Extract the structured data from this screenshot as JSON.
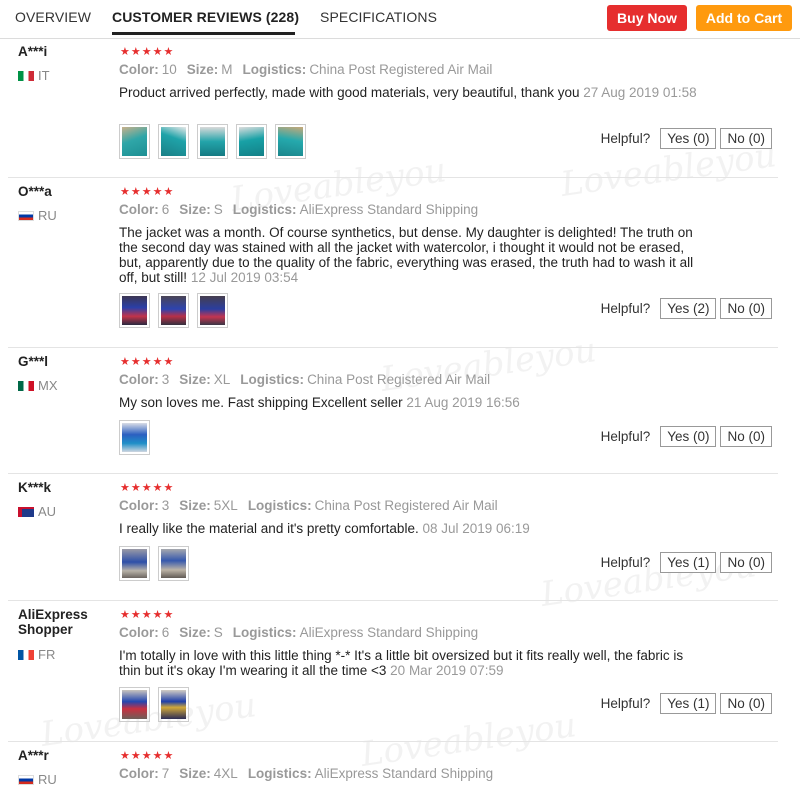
{
  "tabs": {
    "overview": "OVERVIEW",
    "reviews": "CUSTOMER REVIEWS (228)",
    "specs": "SPECIFICATIONS"
  },
  "actions": {
    "buy_now": "Buy Now",
    "add_to_cart": "Add to Cart"
  },
  "labels": {
    "color": "Color:",
    "size": "Size:",
    "logistics": "Logistics:",
    "helpful": "Helpful?"
  },
  "stars_glyph": "★★★★★",
  "reviews": [
    {
      "reviewer": "A***i",
      "country": "IT",
      "color": "10",
      "size": "M",
      "logistics": "China Post Registered Air Mail",
      "text": "Product arrived perfectly, made with good materials, very beautiful, thank you",
      "date": "27 Aug 2019 01:58",
      "yes": "Yes (0)",
      "no": "No (0)"
    },
    {
      "reviewer": "O***a",
      "country": "RU",
      "color": "6",
      "size": "S",
      "logistics": "AliExpress Standard Shipping",
      "text": "The jacket was a month. Of course synthetics, but dense. My daughter is delighted! The truth on the second day was stained with all the jacket with watercolor, i thought it would not be erased, but, apparently due to the quality of the fabric, everything was erased, the truth had to wash it all off, but still!",
      "date": "12 Jul 2019 03:54",
      "yes": "Yes (2)",
      "no": "No (0)"
    },
    {
      "reviewer": "G***l",
      "country": "MX",
      "color": "3",
      "size": "XL",
      "logistics": "China Post Registered Air Mail",
      "text": "My son loves me. Fast shipping Excellent seller",
      "date": "21 Aug 2019 16:56",
      "yes": "Yes (0)",
      "no": "No (0)"
    },
    {
      "reviewer": "K***k",
      "country": "AU",
      "color": "3",
      "size": "5XL",
      "logistics": "China Post Registered Air Mail",
      "text": "I really like the material and it's pretty comfortable.",
      "date": "08 Jul 2019 06:19",
      "yes": "Yes (1)",
      "no": "No (0)"
    },
    {
      "reviewer": "AliExpress Shopper",
      "country": "FR",
      "color": "6",
      "size": "S",
      "logistics": "AliExpress Standard Shipping",
      "text": "I'm totally in love with this little thing *-* It's a little bit oversized but it fits really well, the fabric is thin but it's okay I'm wearing it all the time <3",
      "date": "20 Mar 2019 07:59",
      "yes": "Yes (1)",
      "no": "No (0)"
    },
    {
      "reviewer": "A***r",
      "country": "RU",
      "color": "7",
      "size": "4XL",
      "logistics": "AliExpress Standard Shipping"
    }
  ],
  "watermark": "Loveableyou"
}
